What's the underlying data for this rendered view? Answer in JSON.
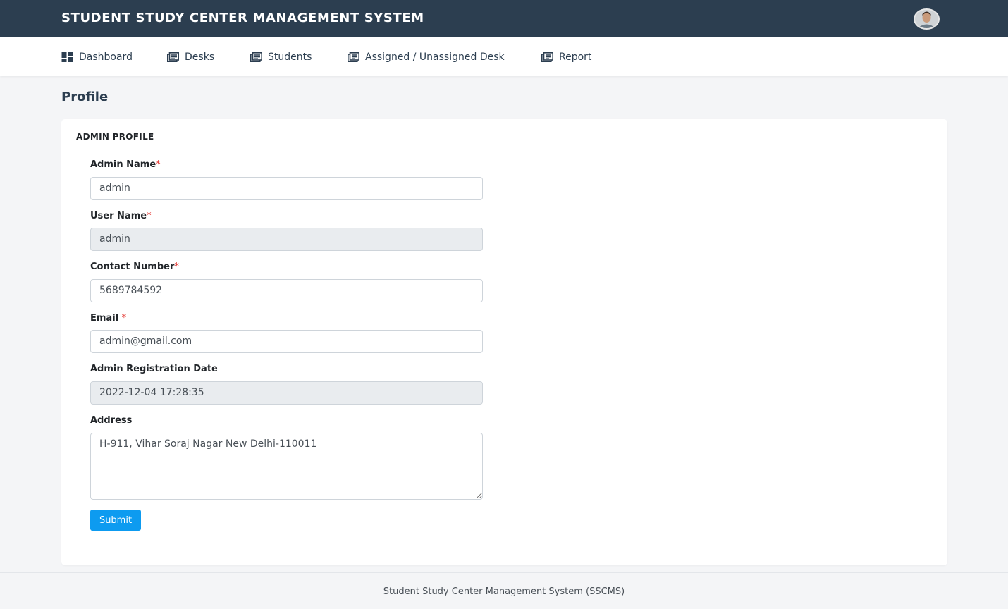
{
  "header": {
    "app_title": "STUDENT STUDY CENTER MANAGEMENT SYSTEM",
    "avatar_icon": "user-avatar"
  },
  "nav": {
    "items": [
      {
        "label": "Dashboard",
        "icon": "dashboard-icon"
      },
      {
        "label": "Desks",
        "icon": "list-icon"
      },
      {
        "label": "Students",
        "icon": "list-icon"
      },
      {
        "label": "Assigned / Unassigned Desk",
        "icon": "list-icon"
      },
      {
        "label": "Report",
        "icon": "list-icon"
      }
    ]
  },
  "page": {
    "title": "Profile"
  },
  "card": {
    "title": "ADMIN PROFILE",
    "fields": {
      "admin_name": {
        "label": "Admin Name",
        "required": "*",
        "value": "admin"
      },
      "user_name": {
        "label": "User Name",
        "required": "*",
        "value": "admin"
      },
      "contact_number": {
        "label": "Contact Number",
        "required": "*",
        "value": "5689784592"
      },
      "email": {
        "label": "Email",
        "required": "*",
        "value": "admin@gmail.com"
      },
      "registration_date": {
        "label": "Admin Registration Date",
        "value": "2022-12-04 17:28:35"
      },
      "address": {
        "label": "Address",
        "value": "H-911, Vihar Soraj Nagar New Delhi-110011"
      }
    },
    "submit_label": "Submit"
  },
  "footer": {
    "text": "Student Study Center Management System (SSCMS)"
  },
  "colors": {
    "topbar": "#2c3e50",
    "accent": "#0d9bf0",
    "required": "#e3342f"
  }
}
